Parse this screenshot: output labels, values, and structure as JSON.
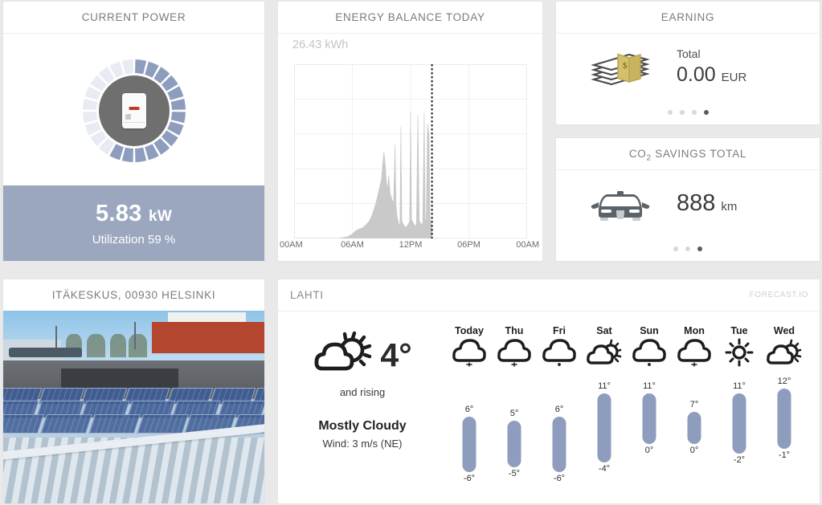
{
  "power": {
    "title": "CURRENT POWER",
    "value": "5.83",
    "unit": "kW",
    "utilization": "Utilization 59 %",
    "utilization_percent": 59,
    "gauge_segments": 24,
    "gauge_filled": 14,
    "icon": "inverter-icon",
    "colors": {
      "band": "#9aa7bf",
      "segment_on": "#8e9dbd",
      "segment_off": "#e8ecf2"
    }
  },
  "energy": {
    "title": "ENERGY BALANCE TODAY",
    "total": "26.43 kWh",
    "x_labels": [
      "00AM",
      "06AM",
      "12PM",
      "06PM",
      "00AM"
    ]
  },
  "chart_data": {
    "type": "area",
    "title": "ENERGY BALANCE TODAY",
    "subtitle": "26.43 kWh",
    "xlabel": "",
    "ylabel": "",
    "x_tick_labels": [
      "00AM",
      "06AM",
      "12PM",
      "06PM",
      "00AM"
    ],
    "x_tick_hours": [
      0,
      6,
      12,
      18,
      24
    ],
    "xlim": [
      0,
      24
    ],
    "ylim": [
      0,
      10
    ],
    "grid": true,
    "now_marker_hour": 14.2,
    "now_marker_style": "dotted-vertical",
    "fill_color": "#c9c9c9",
    "x": [
      0,
      0.5,
      1,
      1.5,
      2,
      2.5,
      3,
      3.5,
      4,
      4.5,
      5,
      5.5,
      6,
      6.25,
      6.5,
      6.75,
      7,
      7.25,
      7.5,
      7.75,
      8,
      8.25,
      8.5,
      8.75,
      9,
      9.1,
      9.25,
      9.4,
      9.5,
      9.6,
      9.75,
      9.9,
      10,
      10.1,
      10.25,
      10.4,
      10.5,
      10.6,
      10.75,
      10.9,
      11,
      11.1,
      11.25,
      11.4,
      11.5,
      11.6,
      11.75,
      11.9,
      12,
      12.1,
      12.25,
      12.4,
      12.5,
      12.6,
      12.75,
      12.9,
      13,
      13.1,
      13.25,
      13.4,
      13.5,
      13.6,
      13.75,
      13.9,
      14,
      14.1,
      14.2
    ],
    "y": [
      0,
      0,
      0,
      0,
      0,
      0,
      0,
      0,
      0,
      0,
      0.05,
      0.1,
      0.25,
      0.4,
      0.5,
      0.55,
      0.6,
      0.7,
      0.85,
      1.0,
      1.3,
      1.7,
      2.2,
      2.8,
      3.4,
      4.1,
      5.0,
      4.2,
      3.3,
      2.8,
      3.6,
      2.6,
      2.4,
      2.2,
      2.1,
      5.4,
      2.0,
      1.3,
      0.9,
      0.7,
      6.4,
      1.0,
      0.8,
      0.7,
      0.6,
      0.7,
      0.8,
      1.0,
      7.3,
      1.1,
      0.9,
      0.8,
      0.7,
      0.8,
      7.1,
      1.0,
      0.9,
      0.8,
      0.9,
      7.2,
      1.1,
      1.0,
      6.6,
      5.9,
      1.2,
      0.9,
      0.6
    ]
  },
  "earning": {
    "title": "EARNING",
    "label": "Total",
    "value": "0.00",
    "currency": "EUR",
    "icon": "money-stack-icon",
    "dots": 4,
    "active_dot": 4
  },
  "co2": {
    "title_main": "SAVINGS TOTAL",
    "title_prefix": "CO",
    "title_sub": "2",
    "value": "888",
    "unit": "km",
    "icon": "car-icon",
    "dots": 3,
    "active_dot": 3
  },
  "photo": {
    "title": "ITÄKESKUS, 00930 HELSINKI",
    "alt": "rooftop-solar-panels-photo"
  },
  "weather": {
    "city": "LAHTI",
    "brand": "FORECAST.IO",
    "current": {
      "temp": "4°",
      "trend": "and rising",
      "condition": "Mostly Cloudy",
      "wind": "Wind: 3 m/s (NE)",
      "icon": "partly-cloudy-icon"
    },
    "forecast": [
      {
        "day": "Today",
        "icon": "cloud-snow-icon",
        "high": "6°",
        "low": "-6°",
        "high_val": 6,
        "low_val": -6
      },
      {
        "day": "Thu",
        "icon": "cloud-snow-icon",
        "high": "5°",
        "low": "-5°",
        "high_val": 5,
        "low_val": -5
      },
      {
        "day": "Fri",
        "icon": "cloud-rain-icon",
        "high": "6°",
        "low": "-6°",
        "high_val": 6,
        "low_val": -6
      },
      {
        "day": "Sat",
        "icon": "partly-cloudy-icon",
        "high": "11°",
        "low": "-4°",
        "high_val": 11,
        "low_val": -4
      },
      {
        "day": "Sun",
        "icon": "cloud-rain-icon",
        "high": "11°",
        "low": "0°",
        "high_val": 11,
        "low_val": 0
      },
      {
        "day": "Mon",
        "icon": "cloud-snow-icon",
        "high": "7°",
        "low": "0°",
        "high_val": 7,
        "low_val": 0
      },
      {
        "day": "Tue",
        "icon": "sun-icon",
        "high": "11°",
        "low": "-2°",
        "high_val": 11,
        "low_val": -2
      },
      {
        "day": "Wed",
        "icon": "partly-cloudy-icon",
        "high": "12°",
        "low": "-1°",
        "high_val": 12,
        "low_val": -1
      }
    ]
  }
}
